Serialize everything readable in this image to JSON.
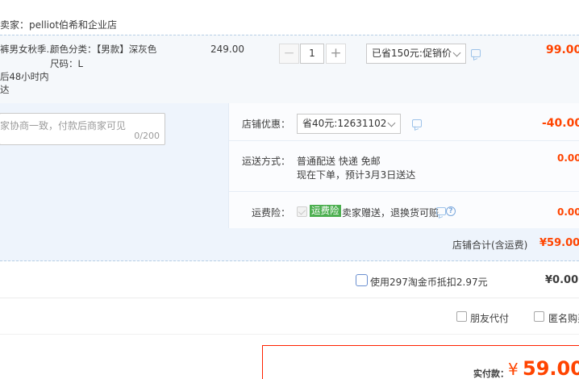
{
  "shop": {
    "label": "卖家：pelliot伯希和企业店"
  },
  "item": {
    "name_line1": "裤男女秋季...",
    "name_line2": "后48小时内",
    "name_line3": "达",
    "sku_color": "颜色分类：【男款】深灰色",
    "sku_size": "尺码：L",
    "unit_price": "249.00",
    "quantity": "1",
    "minus": "−",
    "plus": "+",
    "promo_select": "已省150元:促销价",
    "subtotal": "99.00"
  },
  "message": {
    "placeholder": "家协商一致，付款后商家可见",
    "counter": "0/200"
  },
  "store_discount": {
    "label": "店铺优惠：",
    "select": "省40元:12631102",
    "amount": "-40.00"
  },
  "shipping": {
    "label": "运送方式：",
    "method": "普通配送 快递 免邮",
    "eta": "现在下单，预计3月3日送达",
    "amount": "0.00"
  },
  "insurance": {
    "label": "运费险：",
    "tag": "运费险",
    "desc": "卖家赠送，退换货可赔",
    "help": "?",
    "amount": "0.00"
  },
  "store_total": {
    "label": "店铺合计(含运费)",
    "amount": "¥59.00"
  },
  "coins": {
    "label": "使用297淘金币抵扣2.97元",
    "amount": "¥0.00"
  },
  "options": {
    "friend_pay": "朋友代付",
    "anonymous": "匿名购买"
  },
  "payment": {
    "label": "实付款：",
    "currency": "¥",
    "amount": "59.00"
  },
  "colors": {
    "accent": "#ff4400",
    "tag_green": "#4caf50",
    "row_bg": "#f5f8fb",
    "promo_bg": "#eef4fc"
  }
}
